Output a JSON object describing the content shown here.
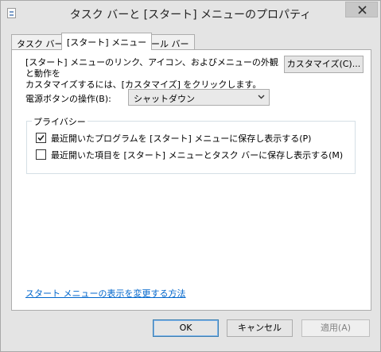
{
  "window": {
    "title": "タスク バーと [スタート] メニューのプロパティ",
    "close_icon": "close-icon"
  },
  "tabs": [
    {
      "label": "タスク バー",
      "active": false
    },
    {
      "label": "[スタート] メニュー",
      "active": true
    },
    {
      "label": "ツール バー",
      "active": false
    }
  ],
  "start_menu": {
    "description": "[スタート] メニューのリンク、アイコン、およびメニューの外観と動作を\nカスタマイズするには、[カスタマイズ] をクリックします。",
    "customize_button": "カスタマイズ(C)...",
    "power_button_label": "電源ボタンの操作(B):",
    "power_button_value": "シャットダウン",
    "privacy_group_label": "プライバシー",
    "privacy_options": [
      {
        "label": "最近開いたプログラムを [スタート] メニューに保存し表示する(P)",
        "checked": true
      },
      {
        "label": "最近開いた項目を [スタート] メニューとタスク バーに保存し表示する(M)",
        "checked": false
      }
    ],
    "help_link": "スタート メニューの表示を変更する方法"
  },
  "footer": {
    "ok": "OK",
    "cancel": "キャンセル",
    "apply": "適用(A)",
    "apply_enabled": false
  }
}
